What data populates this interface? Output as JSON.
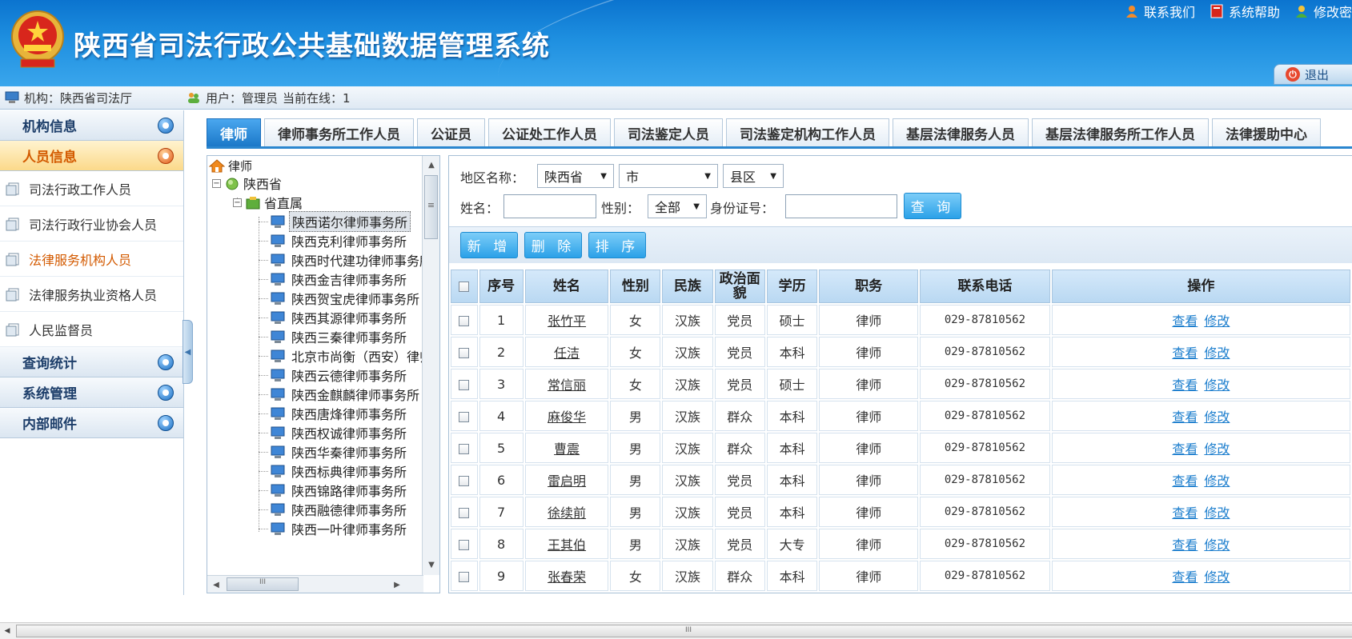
{
  "header": {
    "title": "陕西省司法行政公共基础数据管理系统",
    "links": [
      "联系我们",
      "系统帮助",
      "修改密"
    ],
    "logout_label": "退出"
  },
  "infobar": {
    "org": "机构：陕西省司法厅",
    "user": "用户：管理员",
    "online": "当前在线：1"
  },
  "nav": {
    "headers": [
      "机构信息",
      "人员信息",
      "查询统计",
      "系统管理",
      "内部邮件"
    ],
    "sub_items": [
      "司法行政工作人员",
      "司法行政行业协会人员",
      "法律服务机构人员",
      "法律服务执业资格人员",
      "人民监督员"
    ]
  },
  "tabs": [
    "律师",
    "律师事务所工作人员",
    "公证员",
    "公证处工作人员",
    "司法鉴定人员",
    "司法鉴定机构工作人员",
    "基层法律服务人员",
    "基层法律服务所工作人员",
    "法律援助中心"
  ],
  "tree": {
    "root": "律师",
    "province": "陕西省",
    "group": "省直属",
    "firms": [
      "陕西诺尔律师事务所",
      "陕西克利律师事务所",
      "陕西时代建功律师事务所",
      "陕西金吉律师事务所",
      "陕西贺宝虎律师事务所",
      "陕西其源律师事务所",
      "陕西三秦律师事务所",
      "北京市尚衡（西安）律师事务所",
      "陕西云德律师事务所",
      "陕西金麒麟律师事务所",
      "陕西唐烽律师事务所",
      "陕西权诚律师事务所",
      "陕西华秦律师事务所",
      "陕西标典律师事务所",
      "陕西锦路律师事务所",
      "陕西融德律师事务所",
      "陕西一叶律师事务所"
    ],
    "scroll_thumb": "III",
    "scroll_grip": "≡"
  },
  "search": {
    "region_label": "地区名称：",
    "province_value": "陕西省",
    "city_value": "市",
    "county_value": "县区",
    "name_label": "姓名：",
    "name_value": "",
    "gender_label": "性别：",
    "gender_value": "全部",
    "id_label": "身份证号：",
    "id_value": "",
    "query_button": "查 询"
  },
  "actions": [
    "新 增",
    "删 除",
    "排 序"
  ],
  "table": {
    "headers": [
      "序号",
      "姓名",
      "性别",
      "民族",
      "政治面貌",
      "学历",
      "职务",
      "联系电话",
      "操作"
    ],
    "rows": [
      {
        "no": "1",
        "name": "张竹平",
        "gender": "女",
        "ethnic": "汉族",
        "political": "党员",
        "edu": "硕士",
        "title": "律师",
        "phone": "029-87810562"
      },
      {
        "no": "2",
        "name": "任洁",
        "gender": "女",
        "ethnic": "汉族",
        "political": "党员",
        "edu": "本科",
        "title": "律师",
        "phone": "029-87810562"
      },
      {
        "no": "3",
        "name": "常信丽",
        "gender": "女",
        "ethnic": "汉族",
        "political": "党员",
        "edu": "硕士",
        "title": "律师",
        "phone": "029-87810562"
      },
      {
        "no": "4",
        "name": "麻俊华",
        "gender": "男",
        "ethnic": "汉族",
        "political": "群众",
        "edu": "本科",
        "title": "律师",
        "phone": "029-87810562"
      },
      {
        "no": "5",
        "name": "曹震",
        "gender": "男",
        "ethnic": "汉族",
        "political": "群众",
        "edu": "本科",
        "title": "律师",
        "phone": "029-87810562"
      },
      {
        "no": "6",
        "name": "雷启明",
        "gender": "男",
        "ethnic": "汉族",
        "political": "党员",
        "edu": "本科",
        "title": "律师",
        "phone": "029-87810562"
      },
      {
        "no": "7",
        "name": "徐续前",
        "gender": "男",
        "ethnic": "汉族",
        "political": "党员",
        "edu": "本科",
        "title": "律师",
        "phone": "029-87810562"
      },
      {
        "no": "8",
        "name": "王其伯",
        "gender": "男",
        "ethnic": "汉族",
        "political": "党员",
        "edu": "大专",
        "title": "律师",
        "phone": "029-87810562"
      },
      {
        "no": "9",
        "name": "张春荣",
        "gender": "女",
        "ethnic": "汉族",
        "political": "群众",
        "edu": "本科",
        "title": "律师",
        "phone": "029-87810562"
      }
    ],
    "op_view": "查看",
    "op_edit": "修改"
  },
  "page_scroll_thumb": "III"
}
